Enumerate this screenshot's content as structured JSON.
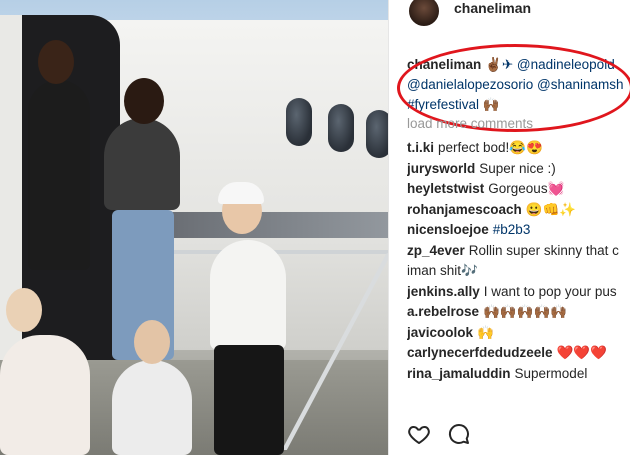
{
  "post": {
    "author": "chaneliman"
  },
  "caption": {
    "user": "chaneliman",
    "line1_rest": "✌🏾✈ @nadineleopold",
    "line2": "@danielalopezosorio @shaninamsh",
    "line3": "#fyrefestival 🙌🏾"
  },
  "load_more": "load more comments",
  "comments": [
    {
      "user": "t.i.ki",
      "text": "perfect bod!😂😍"
    },
    {
      "user": "jurysworld",
      "text": "Super nice :)"
    },
    {
      "user": "heyletstwist",
      "text": "Gorgeous💓"
    },
    {
      "user": "rohanjamescoach",
      "text": "😀👊✨"
    },
    {
      "user": "nicensloejoe",
      "text": "#b2b3"
    },
    {
      "user": "zp_4ever",
      "text": "Rollin super skinny that c iman shit🎶"
    },
    {
      "user": "jenkins.ally",
      "text": "I want to pop your pus"
    },
    {
      "user": "a.rebelrose",
      "text": "🙌🏾🙌🏾🙌🏾🙌🏾🙌🏾"
    },
    {
      "user": "javicoolok",
      "text": "🙌"
    },
    {
      "user": "carlynecerfdedudzeele",
      "text": "❤️❤️❤️"
    },
    {
      "user": "rina_jamaluddin",
      "text": "Supermodel"
    }
  ],
  "actions": {
    "like_icon": "heart-icon",
    "comment_icon": "comment-bubble-icon"
  },
  "colors": {
    "annotation_oval": "#e0161d",
    "mention": "#003569",
    "muted": "#999999"
  }
}
